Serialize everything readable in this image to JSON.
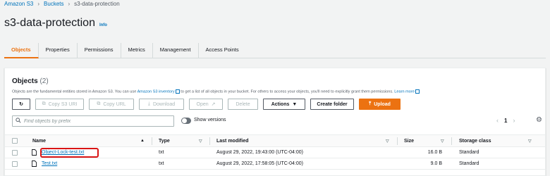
{
  "breadcrumb": [
    "Amazon S3",
    "Buckets",
    "s3-data-protection"
  ],
  "page": {
    "title": "s3-data-protection",
    "info": "Info"
  },
  "tabs": [
    {
      "label": "Objects",
      "active": true
    },
    {
      "label": "Properties"
    },
    {
      "label": "Permissions"
    },
    {
      "label": "Metrics"
    },
    {
      "label": "Management"
    },
    {
      "label": "Access Points"
    }
  ],
  "objects_panel": {
    "title": "Objects",
    "count": "(2)",
    "desc_1": "Objects are the fundamental entities stored in Amazon S3. You can use ",
    "desc_link_1": "Amazon S3 inventory",
    "desc_2": " to get a list of all objects in your bucket. For others to access your objects, you'll need to explicitly grant them permissions. ",
    "desc_link_2": "Learn more"
  },
  "toolbar": {
    "copy_uri": "Copy S3 URI",
    "copy_url": "Copy URL",
    "download": "Download",
    "open": "Open",
    "delete": "Delete",
    "actions": "Actions",
    "create_folder": "Create folder",
    "upload": "Upload"
  },
  "search": {
    "placeholder": "Find objects by prefix"
  },
  "show_versions": "Show versions",
  "pagination": {
    "page": "1"
  },
  "table": {
    "headers": {
      "name": "Name",
      "type": "Type",
      "last_modified": "Last modified",
      "size": "Size",
      "storage_class": "Storage class"
    },
    "rows": [
      {
        "name": "Object-Lock-test.txt",
        "type": "txt",
        "last_modified": "August 29, 2022, 19:43:00 (UTC-04:00)",
        "size": "16.0 B",
        "storage_class": "Standard",
        "highlighted": true
      },
      {
        "name": "Test.txt",
        "type": "txt",
        "last_modified": "August 29, 2022, 17:58:05 (UTC-04:00)",
        "size": "9.0 B",
        "storage_class": "Standard"
      }
    ]
  },
  "colors": {
    "accent": "#ec7211",
    "link": "#0073bb",
    "highlight": "#d91515"
  }
}
